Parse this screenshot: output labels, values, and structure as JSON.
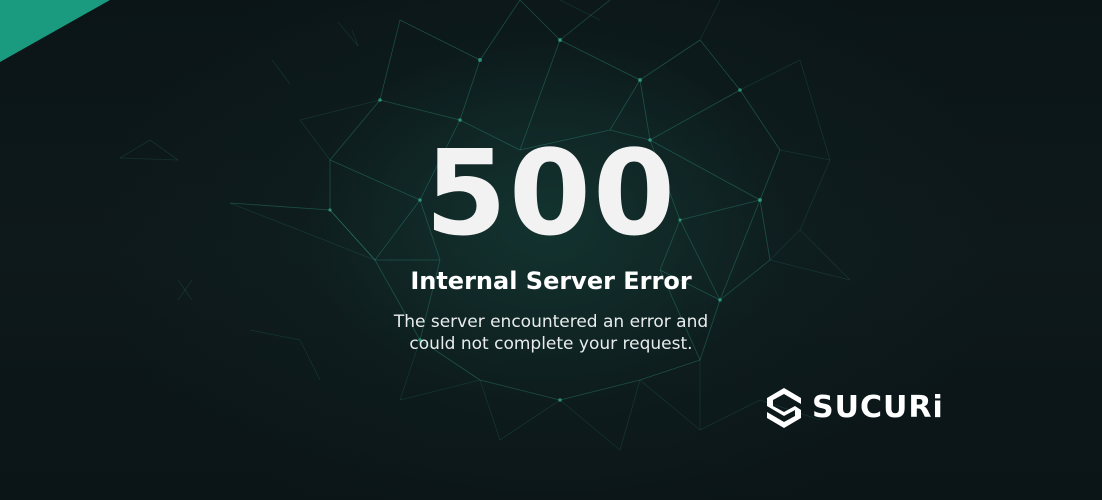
{
  "error": {
    "code": "500",
    "title": "Internal Server Error",
    "description_lines": [
      "The server encountered an error and",
      "could not complete your request."
    ]
  },
  "brand": {
    "name": "SUCURi",
    "logo_icon": "sucuri-shield-icon"
  },
  "colors": {
    "background": "#0c1618",
    "accent": "#1a9a7f",
    "mesh": "#2f8a78",
    "text": "#ffffff"
  }
}
